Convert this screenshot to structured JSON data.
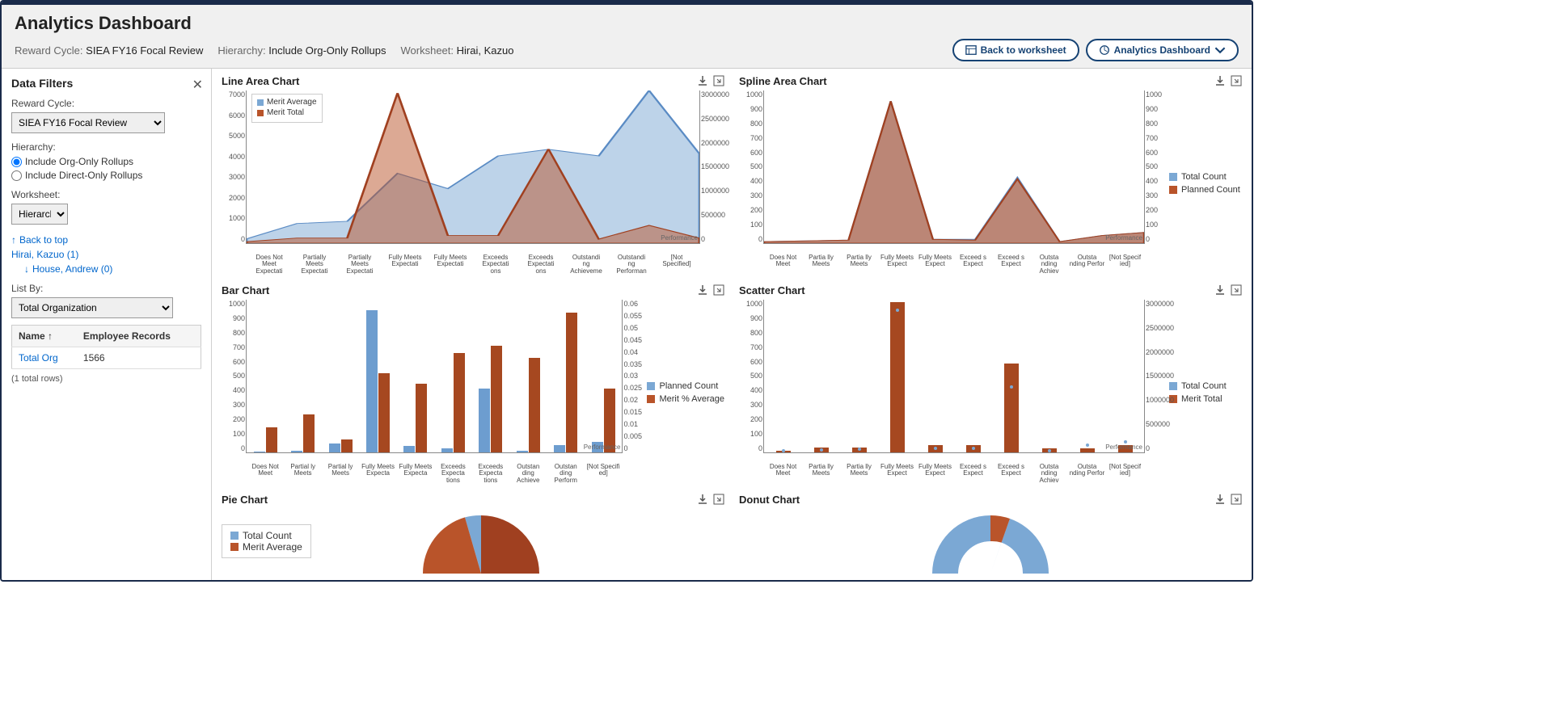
{
  "chart_data": [
    {
      "type": "area",
      "title": "Line Area Chart",
      "categories": [
        "Does Not Meet Expectati",
        "Partially Meets Expectati",
        "Partially Meets Expectati",
        "Fully Meets Expectati",
        "Fully Meets Expectati",
        "Exceeds Expectati ons",
        "Exceeds Expectati ons",
        "Outstandi ng Achieveme",
        "Outstandi ng Performan",
        "[Not Specified]"
      ],
      "series": [
        {
          "name": "Merit Average",
          "axis": "left",
          "values": [
            200,
            900,
            1000,
            3200,
            2500,
            4000,
            4300,
            4000,
            7000,
            4100
          ]
        },
        {
          "name": "Merit Total",
          "axis": "right",
          "values": [
            30000,
            100000,
            100000,
            2950000,
            150000,
            150000,
            1850000,
            80000,
            350000,
            100000
          ]
        }
      ],
      "ylim_left": [
        0,
        7000
      ],
      "ylim_right": [
        0,
        3000000
      ],
      "ylabel_left": "Merit Average",
      "ylabel_right": "Merit Total",
      "xlabel": "Performance"
    },
    {
      "type": "area",
      "title": "Spline Area Chart",
      "categories": [
        "Does Not Meet",
        "Partia lly Meets",
        "Partia lly Meets",
        "Fully Meets Expect",
        "Fully Meets Expect",
        "Exceed s Expect",
        "Exceed s Expect",
        "Outsta nding Achiev",
        "Outsta nding Perfor",
        "[Not Specif ied]"
      ],
      "series": [
        {
          "name": "Total Count",
          "axis": "left",
          "values": [
            10,
            15,
            20,
            930,
            25,
            25,
            430,
            10,
            50,
            70
          ]
        },
        {
          "name": "Planned Count",
          "axis": "right",
          "values": [
            10,
            15,
            20,
            930,
            25,
            20,
            420,
            10,
            50,
            70
          ]
        }
      ],
      "ylim_left": [
        0,
        1000
      ],
      "ylim_right": [
        0,
        1000
      ],
      "ylabel_left": "Total Count",
      "ylabel_right": "Planned Count",
      "xlabel": "Performance"
    },
    {
      "type": "bar",
      "title": "Bar Chart",
      "categories": [
        "Does Not Meet",
        "Partial ly Meets",
        "Partial ly Meets",
        "Fully Meets Expecta",
        "Fully Meets Expecta",
        "Exceeds Expecta tions",
        "Exceeds Expecta tions",
        "Outstan ding Achieve",
        "Outstan ding Perform",
        "[Not Specifi ed]"
      ],
      "series": [
        {
          "name": "Planned Count",
          "axis": "left",
          "values": [
            5,
            10,
            60,
            930,
            40,
            25,
            420,
            10,
            50,
            70
          ]
        },
        {
          "name": "Merit % Average",
          "axis": "right",
          "values": [
            0.01,
            0.015,
            0.005,
            0.031,
            0.027,
            0.039,
            0.042,
            0.037,
            0.055,
            0.025
          ]
        }
      ],
      "ylim_left": [
        0,
        1000
      ],
      "ylim_right": [
        0,
        0.06
      ],
      "ylabel_left": "Planned Count",
      "ylabel_right": "Merit % Average",
      "xlabel": "Performance"
    },
    {
      "type": "scatter",
      "title": "Scatter Chart",
      "categories": [
        "Does Not Meet",
        "Partia lly Meets",
        "Partia lly Meets",
        "Fully Meets Expect",
        "Fully Meets Expect",
        "Exceed s Expect",
        "Exceed s Expect",
        "Outsta nding Achiev",
        "Outsta nding Perfor",
        "[Not Specif ied]"
      ],
      "series": [
        {
          "name": "Total Count",
          "axis": "left",
          "type": "scatter",
          "values": [
            10,
            15,
            20,
            930,
            25,
            25,
            430,
            10,
            50,
            70
          ]
        },
        {
          "name": "Merit Total",
          "axis": "right",
          "type": "bar",
          "values": [
            30000,
            100000,
            100000,
            2950000,
            150000,
            150000,
            1750000,
            80000,
            80000,
            150000
          ]
        }
      ],
      "ylim_left": [
        0,
        1000
      ],
      "ylim_right": [
        0,
        3000000
      ],
      "ylabel_left": "Total Count",
      "ylabel_right": "Merit Total",
      "xlabel": "Performance"
    },
    {
      "type": "pie",
      "title": "Pie Chart",
      "series": [
        {
          "name": "Total Count"
        },
        {
          "name": "Merit Average"
        }
      ]
    },
    {
      "type": "pie",
      "title": "Donut Chart"
    }
  ],
  "header": {
    "title": "Analytics Dashboard",
    "reward_cycle_label": "Reward Cycle:",
    "reward_cycle_value": "SIEA FY16 Focal Review",
    "hierarchy_label": "Hierarchy:",
    "hierarchy_value": "Include Org-Only Rollups",
    "worksheet_label": "Worksheet:",
    "worksheet_value": "Hirai, Kazuo",
    "btn_back": "Back to worksheet",
    "btn_dashboard": "Analytics Dashboard"
  },
  "filters": {
    "title": "Data Filters",
    "reward_cycle_label": "Reward Cycle:",
    "reward_cycle_value": "SIEA FY16 Focal Review",
    "hierarchy_label": "Hierarchy:",
    "hierarchy_opt1": "Include Org-Only Rollups",
    "hierarchy_opt2": "Include Direct-Only Rollups",
    "worksheet_label": "Worksheet:",
    "worksheet_select": "Hierarchy",
    "back_to_top": "Back to top",
    "tree_root": "Hirai, Kazuo (1)",
    "tree_child": "House, Andrew (0)",
    "listby_label": "List By:",
    "listby_value": "Total Organization",
    "col_name": "Name",
    "col_records": "Employee Records",
    "row_name": "Total Org",
    "row_count": "1566",
    "total_rows": "(1 total rows)"
  },
  "charts": {
    "line_area_title": "Line Area Chart",
    "spline_area_title": "Spline Area Chart",
    "bar_title": "Bar Chart",
    "scatter_title": "Scatter Chart",
    "pie_title": "Pie Chart",
    "donut_title": "Donut Chart",
    "legend_merit_avg": "Merit Average",
    "legend_merit_total": "Merit Total",
    "legend_total_count": "Total Count",
    "legend_planned_count": "Planned Count",
    "legend_merit_pct": "Merit % Average",
    "xlabel_performance": "Performance",
    "ylabel_merit_avg": "Merit Average",
    "ylabel_merit_total": "Merit Total",
    "ylabel_total_count": "Total Count",
    "ylabel_planned_count": "Planned Count",
    "ylabel_merit_pct": "Merit % Average"
  }
}
